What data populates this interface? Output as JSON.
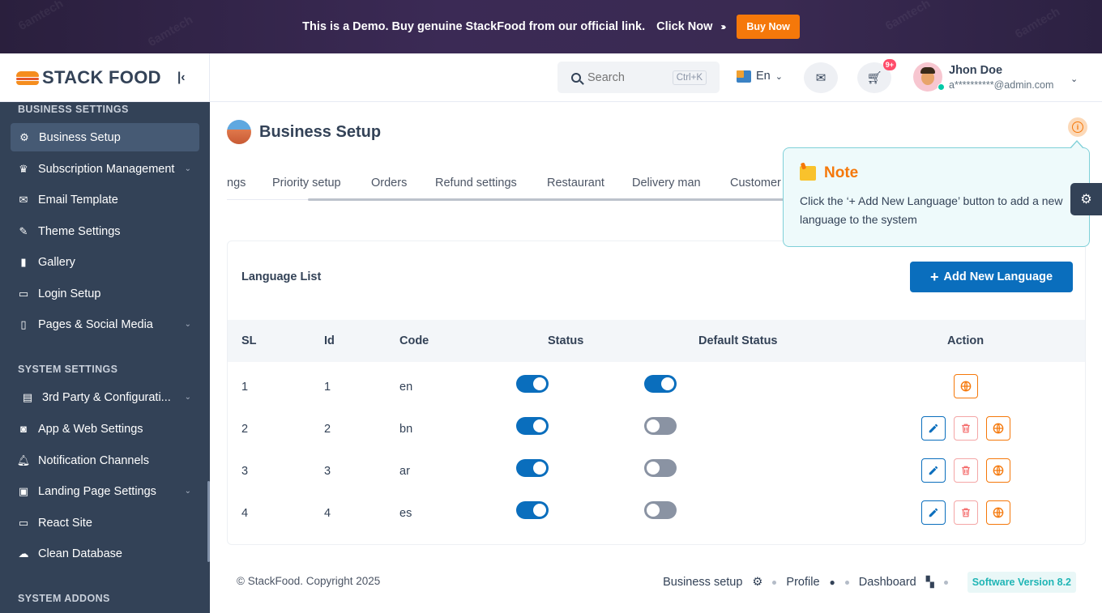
{
  "banner": {
    "text": "This is a Demo. Buy genuine StackFood from our official link.",
    "click_text": "Click Now",
    "arrows": "››››",
    "buy_label": "Buy Now",
    "watermark": "6amtech"
  },
  "logo": {
    "text": "STACK FOOD",
    "collapse_icon": "collapse-left-icon"
  },
  "sidebar": {
    "sections": [
      {
        "label": "BUSINESS SETTINGS"
      },
      {
        "label": "SYSTEM SETTINGS"
      },
      {
        "label": "SYSTEM ADDONS"
      }
    ],
    "items": [
      {
        "label": "Business Setup",
        "icon": "gear-icon",
        "active": true
      },
      {
        "label": "Subscription Management",
        "icon": "crown-icon",
        "has_submenu": true
      },
      {
        "label": "Email Template",
        "icon": "mail-icon"
      },
      {
        "label": "Theme Settings",
        "icon": "brush-icon"
      },
      {
        "label": "Gallery",
        "icon": "book-icon"
      },
      {
        "label": "Login Setup",
        "icon": "devices-icon"
      },
      {
        "label": "Pages & Social Media",
        "icon": "pages-icon",
        "has_submenu": true
      },
      {
        "label": "3rd Party & Configurati...",
        "icon": "server-icon",
        "has_submenu": true
      },
      {
        "label": "App & Web Settings",
        "icon": "android-icon"
      },
      {
        "label": "Notification Channels",
        "icon": "bell-icon"
      },
      {
        "label": "Landing Page Settings",
        "icon": "landing-icon",
        "has_submenu": true
      },
      {
        "label": "React Site",
        "icon": "monitor-icon"
      },
      {
        "label": "Clean Database",
        "icon": "cloud-icon"
      }
    ]
  },
  "header": {
    "search_placeholder": "Search",
    "search_shortcut": "Ctrl+K",
    "language": "En",
    "cart_badge": "9+",
    "user_name": "Jhon Doe",
    "user_email": "a**********@admin.com"
  },
  "page": {
    "title": "Business Setup",
    "tabs": [
      "ngs",
      "Priority setup",
      "Orders",
      "Refund settings",
      "Restaurant",
      "Delivery man",
      "Customer"
    ]
  },
  "note": {
    "title": "Note",
    "text": "Click the ‘+ Add New Language’ button to add a new language to the system"
  },
  "language_list": {
    "title": "Language List",
    "add_button": "Add New Language",
    "columns": [
      "SL",
      "Id",
      "Code",
      "Status",
      "Default Status",
      "Action"
    ],
    "rows": [
      {
        "sl": "1",
        "id": "1",
        "code": "en",
        "status": true,
        "default": true,
        "editable": false
      },
      {
        "sl": "2",
        "id": "2",
        "code": "bn",
        "status": true,
        "default": false,
        "editable": true
      },
      {
        "sl": "3",
        "id": "3",
        "code": "ar",
        "status": true,
        "default": false,
        "editable": true
      },
      {
        "sl": "4",
        "id": "4",
        "code": "es",
        "status": true,
        "default": false,
        "editable": true
      }
    ]
  },
  "footer": {
    "copyright": "© StackFood. Copyright 2025",
    "links": [
      {
        "label": "Business setup",
        "icon": "gear-icon"
      },
      {
        "label": "Profile",
        "icon": "user-icon"
      },
      {
        "label": "Dashboard",
        "icon": "dashboard-icon"
      }
    ],
    "version": "Software Version 8.2"
  },
  "colors": {
    "primary": "#0a6ebd",
    "accent": "#f5780a",
    "sidebar": "#334257",
    "danger": "#f46a6a",
    "teal": "#1fb5b5"
  }
}
